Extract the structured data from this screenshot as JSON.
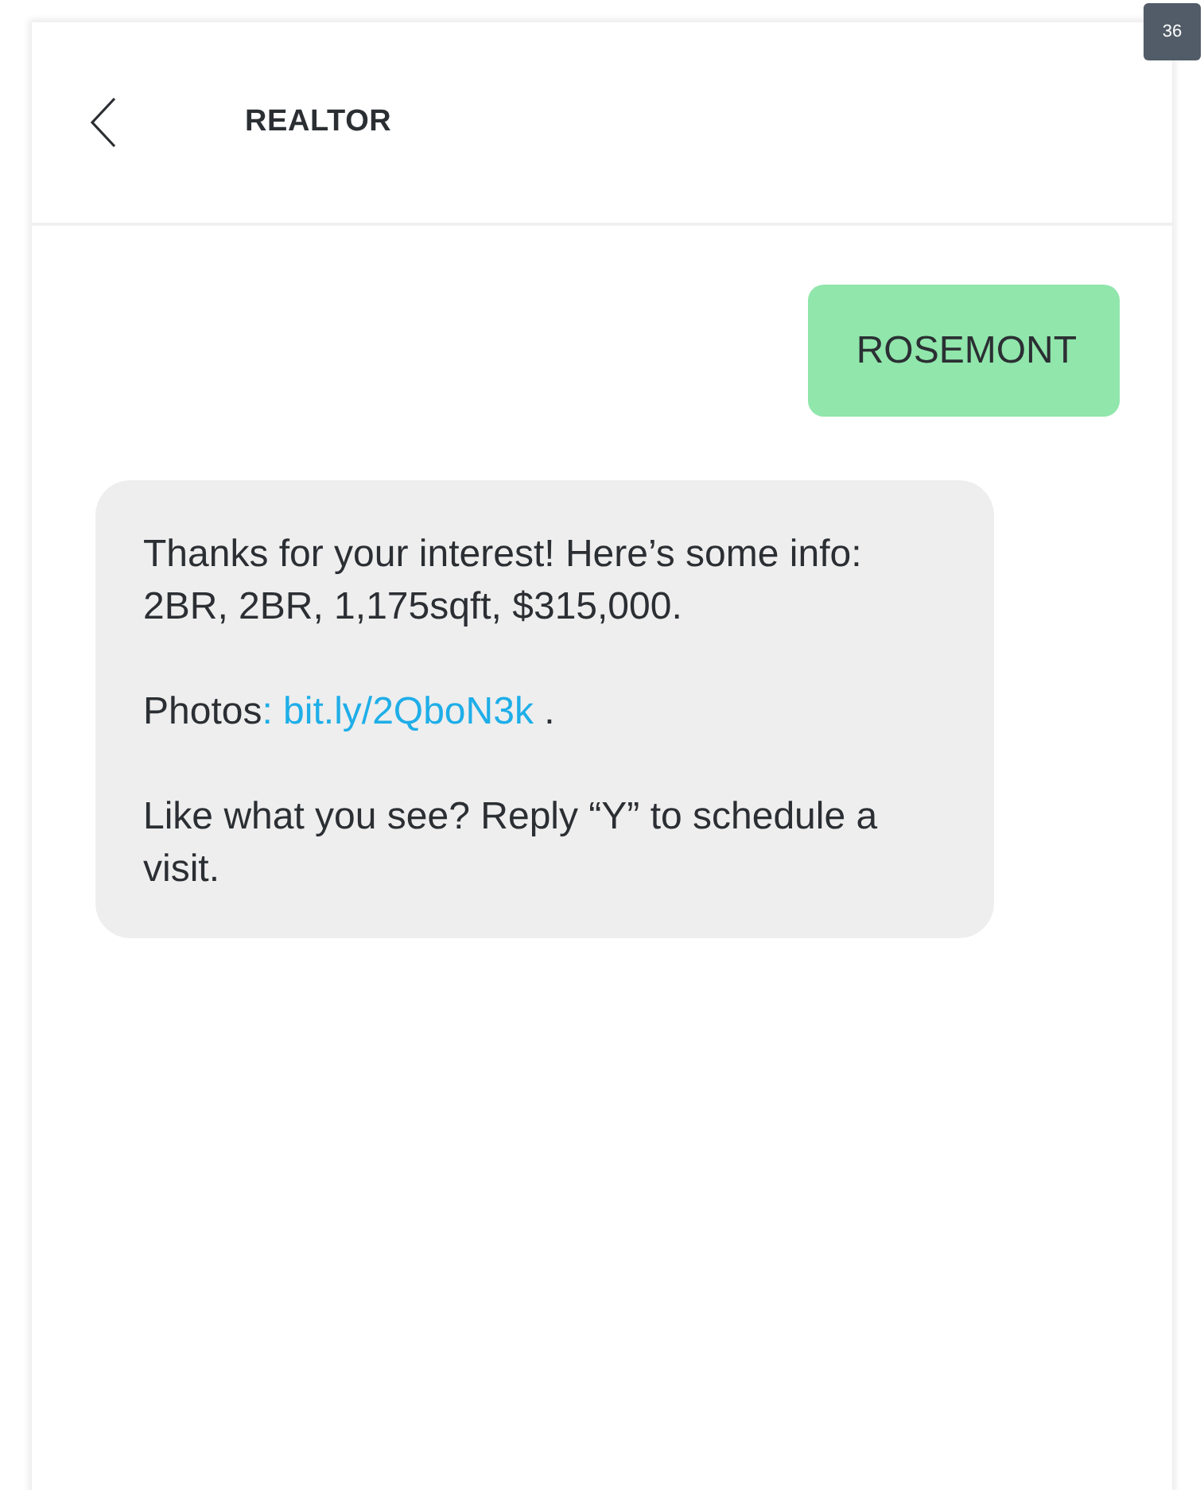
{
  "page_badge": "36",
  "header": {
    "title": "REALTOR"
  },
  "messages": [
    {
      "kind": "sent",
      "paragraphs": [
        {
          "text": "ROSEMONT"
        }
      ]
    },
    {
      "kind": "received",
      "paragraphs": [
        {
          "text": "Thanks for your interest! Here’s some info: 2BR, 2BR, 1,175sqft, $315,000."
        },
        {
          "text": "Photos",
          "link": ": bit.ly/2QboN3k",
          "after": " ."
        },
        {
          "text": "Like what you see? Reply “Y” to schedule a visit."
        }
      ]
    }
  ]
}
